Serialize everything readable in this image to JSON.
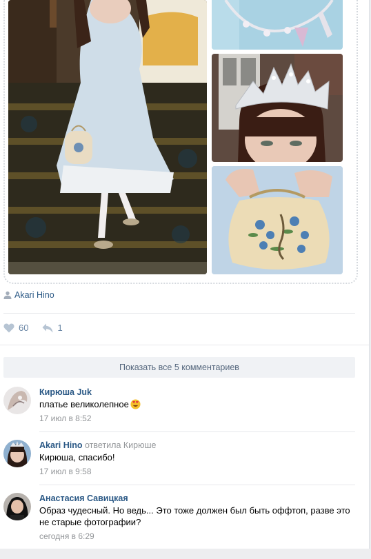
{
  "post": {
    "author_name": "Akari Hino",
    "likes_count": "60",
    "shares_count": "1"
  },
  "comments_header": {
    "show_all_label": "Показать все 5 комментариев"
  },
  "comments": [
    {
      "author": "Кирюша Juk",
      "reply_to": "",
      "text": "платье великолепное",
      "emoji": "heart-eyes-emoji",
      "date": "17 июл в 8:52"
    },
    {
      "author": "Akari Hino",
      "reply_to": "ответила Кирюше",
      "text": "Кирюша, спасибо!",
      "date": "17 июл в 9:58"
    },
    {
      "author": "Анастасия Савицкая",
      "reply_to": "",
      "text": "Образ чудесный. Но ведь... Это тоже должен был быть оффтоп, разве это не старые фотографии?",
      "date": "сегодня в 6:29"
    }
  ],
  "colors": {
    "link": "#2a5885",
    "muted": "#939699",
    "action": "#6b87a6",
    "button_bg": "#f0f2f5"
  },
  "icons": [
    "user-icon",
    "heart-icon",
    "share-icon",
    "heart-eyes-emoji"
  ]
}
